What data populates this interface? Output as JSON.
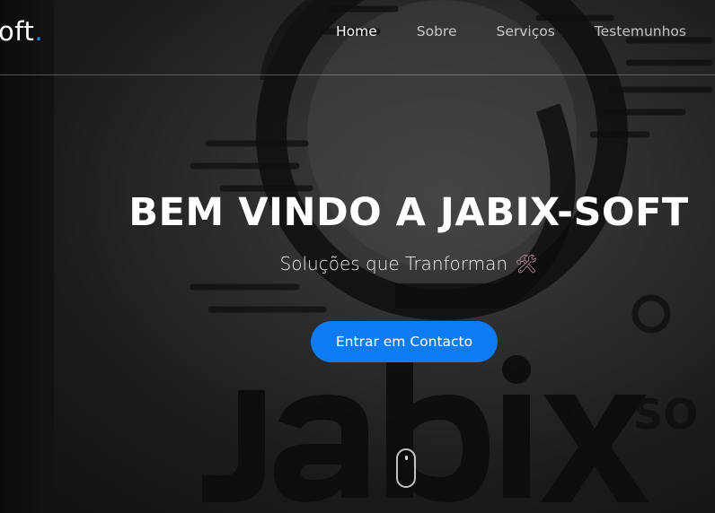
{
  "brand": {
    "logo_text": "oft",
    "logo_dot": ".",
    "accent_color": "#1f88ff"
  },
  "nav": {
    "items": [
      {
        "label": "Home",
        "active": true
      },
      {
        "label": "Sobre",
        "active": false
      },
      {
        "label": "Serviços",
        "active": false
      },
      {
        "label": "Testemunhos",
        "active": false
      }
    ]
  },
  "hero": {
    "title": "BEM VINDO A JABIX-SOFT",
    "subtitle": "Soluções que Tranforman",
    "subtitle_icon": "🛠",
    "cta_label": "Entrar em Contacto",
    "cta_color": "#0d7cf2",
    "scroll_indicator": "mouse-scroll-icon"
  }
}
